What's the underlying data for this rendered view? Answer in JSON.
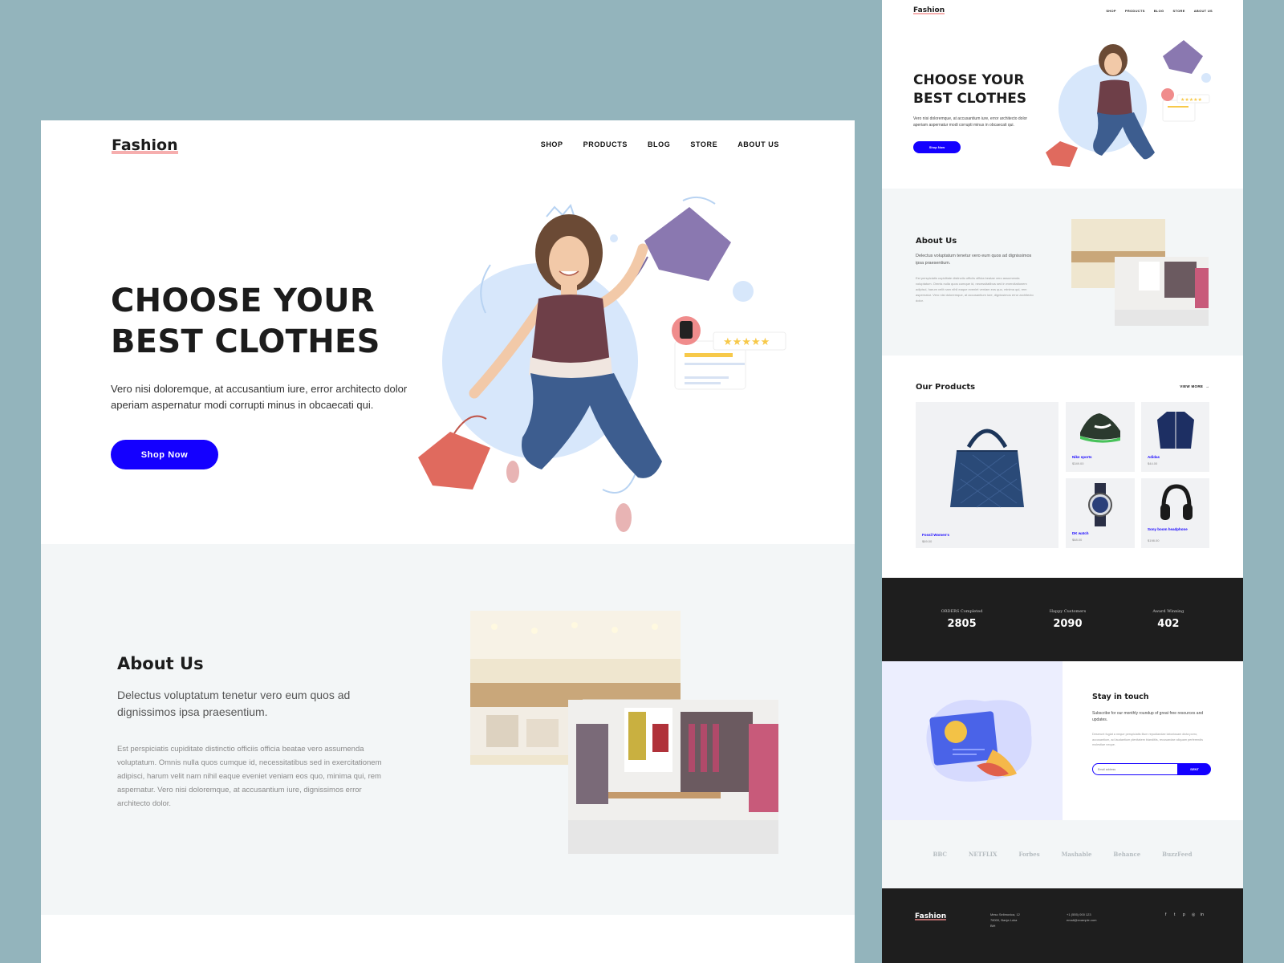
{
  "brand": {
    "logo": "Fashion"
  },
  "nav": [
    "SHOP",
    "PRODUCTS",
    "BLOG",
    "STORE",
    "ABOUT US"
  ],
  "hero": {
    "title_line1": "CHOOSE YOUR",
    "title_line2": "BEST CLOTHES",
    "subtitle": "Vero nisi doloremque, at accusantium iure, error architecto dolor aperiam aspernatur modi corrupti minus in obcaecati qui.",
    "cta": "Shop Now"
  },
  "about": {
    "title": "About Us",
    "lead": "Delectus voluptatum tenetur vero eum quos ad dignissimos ipsa praesentium.",
    "body": "Est perspiciatis cupiditate distinctio officiis officia beatae vero assumenda voluptatum. Omnis nulla quos cumque id, necessitatibus sed in exercitationem adipisci, harum velit nam nihil eaque eveniet veniam eos quo, minima qui, rem aspernatur. Vero nisi doloremque, at accusantium iure, dignissimos error architecto dolor."
  },
  "products": {
    "title": "Our Products",
    "view_more": "VIEW MORE",
    "items": [
      {
        "name": "Fossil Women's",
        "price": "$69.00"
      },
      {
        "name": "Nike sports",
        "price": "$349.00"
      },
      {
        "name": "Adidas",
        "price": "$44.00"
      },
      {
        "name": "DK watch",
        "price": "$68.00"
      },
      {
        "name": "Sony boom headphone",
        "price": "$198.00"
      }
    ]
  },
  "stats": [
    {
      "label": "ORDERS Completed",
      "value": "2805"
    },
    {
      "label": "Happy Customers",
      "value": "2090"
    },
    {
      "label": "Award Winning",
      "value": "402"
    }
  ],
  "newsletter": {
    "title": "Stay in touch",
    "lead": "Subscribe for our monthly roundup of great free resources and updates.",
    "body": "Deserunt fugiat a neque perspiciatis illum repudiandae laboriosam dicta porro, accusantium, ad laudantium plenitatem blanditiis, recusandae aliquam perferendis molestiae neque.",
    "placeholder": "Email address",
    "send": "SENT"
  },
  "brands": [
    "BBC",
    "NETFLIX",
    "Forbes",
    "Mashable",
    "Behance",
    "BuzzFeed"
  ],
  "footer": {
    "address": [
      "Meso Selimovica, 12",
      "78000, Banja Luka",
      "BiH"
    ],
    "contact": [
      "+1 (555) 000 123",
      "email@example.com"
    ]
  },
  "colors": {
    "accent": "#1400ff",
    "background": "#93b4bc",
    "dark": "#1e1e1e",
    "light_section": "#f3f6f7"
  }
}
